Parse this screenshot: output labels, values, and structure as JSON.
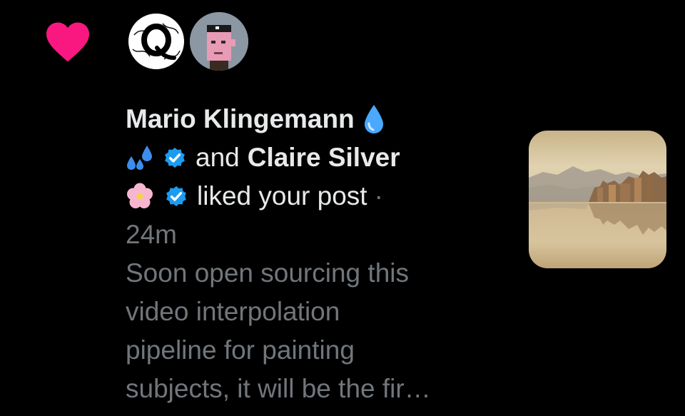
{
  "notification": {
    "type": "like",
    "accent_color": "#f91880",
    "verified_color": "#1d9bf0",
    "user1": {
      "name": "Mario Klingemann",
      "avatar_icon": "q-monogram-avatar",
      "emoji": "droplet"
    },
    "connector": "and",
    "user2": {
      "name": "Claire Silver",
      "avatar_icon": "pixel-punk-avatar",
      "emoji": "cherry-blossom"
    },
    "action": "liked your post",
    "separator": "·",
    "time": "24m",
    "preview_lines": [
      "Soon open sourcing this",
      "video interpolation",
      "pipeline for painting",
      "subjects, it will be the fir…"
    ],
    "thumbnail_icon": "landscape-painting-thumbnail"
  }
}
